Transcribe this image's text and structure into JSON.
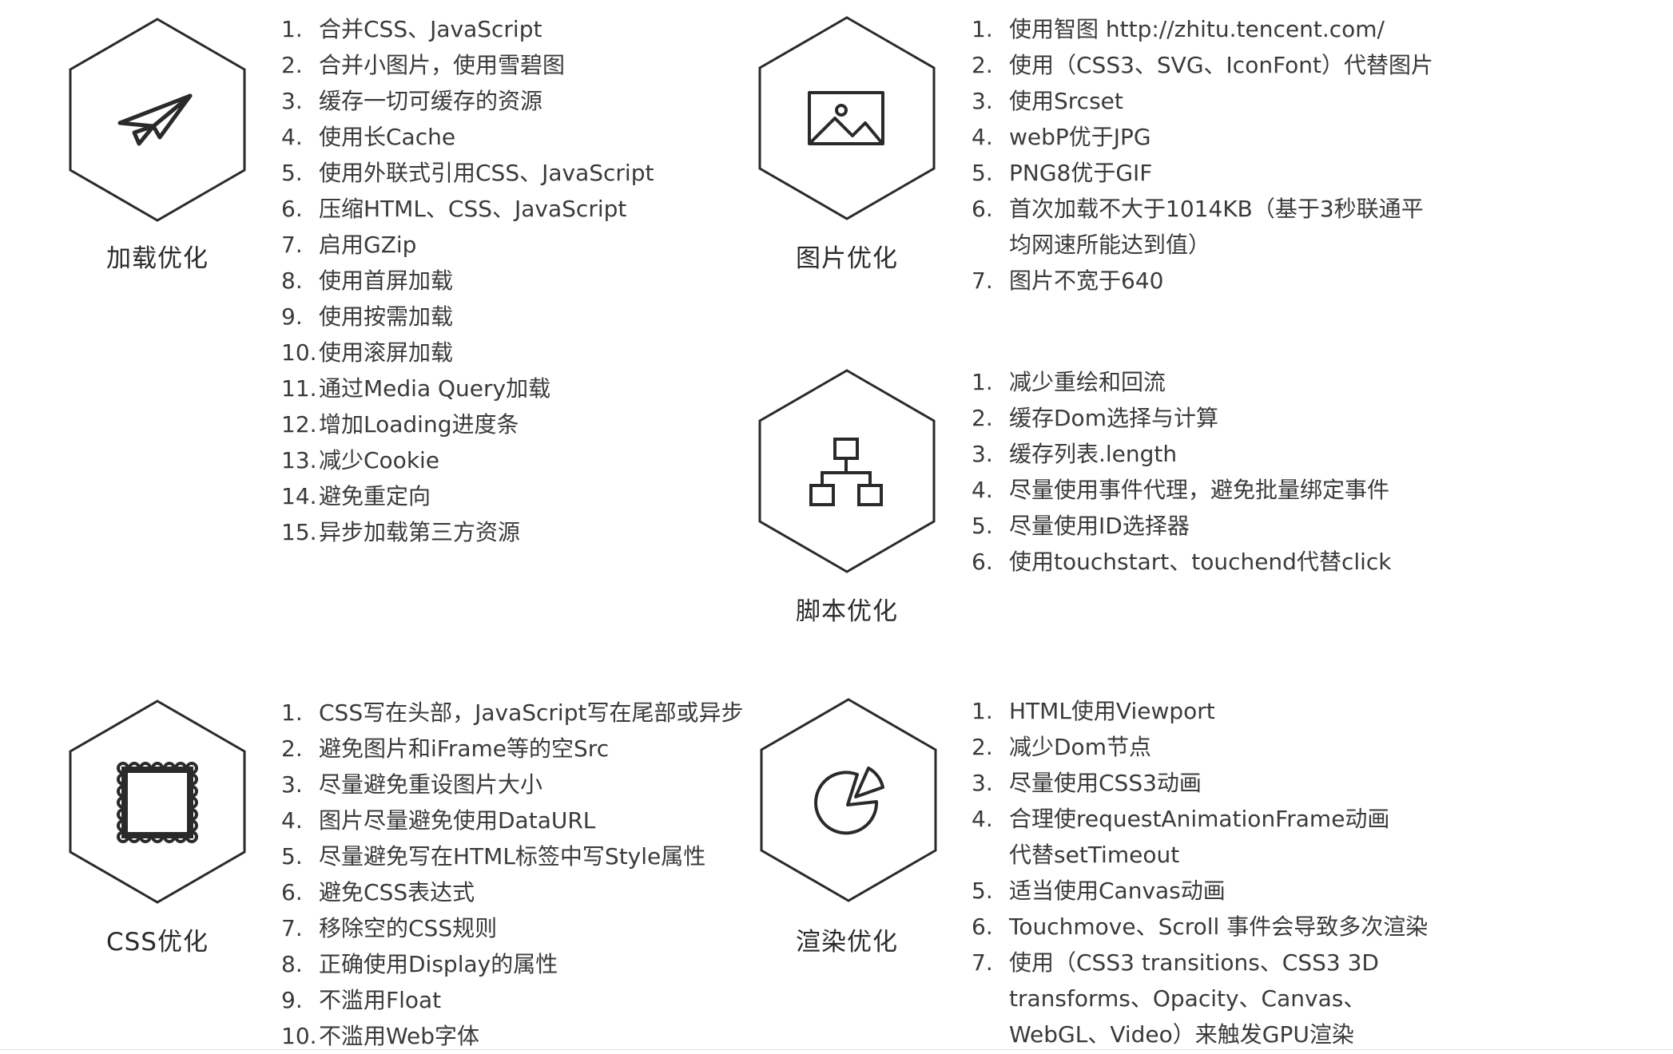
{
  "sections": {
    "loading": {
      "title": "加载优化",
      "icon": "paper-plane-icon",
      "items": [
        {
          "num": "1.",
          "text": "合并CSS、JavaScript"
        },
        {
          "num": "2.",
          "text": "合并小图片，使用雪碧图"
        },
        {
          "num": "3.",
          "text": "缓存一切可缓存的资源"
        },
        {
          "num": "4.",
          "text": "使用长Cache"
        },
        {
          "num": "5.",
          "text": "使用外联式引用CSS、JavaScript"
        },
        {
          "num": "6.",
          "text": "压缩HTML、CSS、JavaScript"
        },
        {
          "num": "7.",
          "text": "启用GZip"
        },
        {
          "num": "8.",
          "text": "使用首屏加载"
        },
        {
          "num": "9.",
          "text": "使用按需加载"
        },
        {
          "num": "10.",
          "text": "使用滚屏加载"
        },
        {
          "num": "11.",
          "text": "通过Media Query加载"
        },
        {
          "num": "12.",
          "text": "增加Loading进度条"
        },
        {
          "num": "13.",
          "text": "减少Cookie"
        },
        {
          "num": "14.",
          "text": "避免重定向"
        },
        {
          "num": "15.",
          "text": "异步加载第三方资源"
        }
      ]
    },
    "image": {
      "title": "图片优化",
      "icon": "image-icon",
      "items": [
        {
          "num": "1.",
          "text": "使用智图 http://zhitu.tencent.com/"
        },
        {
          "num": "2.",
          "text": "使用（CSS3、SVG、IconFont）代替图片"
        },
        {
          "num": "3.",
          "text": "使用Srcset"
        },
        {
          "num": "4.",
          "text": "webP优于JPG"
        },
        {
          "num": "5.",
          "text": "PNG8优于GIF"
        },
        {
          "num": "6.",
          "text": "首次加载不大于1014KB（基于3秒联通平均网速所能达到值）"
        },
        {
          "num": "7.",
          "text": "图片不宽于640"
        }
      ]
    },
    "script": {
      "title": "脚本优化",
      "icon": "sitemap-icon",
      "items": [
        {
          "num": "1.",
          "text": "减少重绘和回流"
        },
        {
          "num": "2.",
          "text": "缓存Dom选择与计算"
        },
        {
          "num": "3.",
          "text": "缓存列表.length"
        },
        {
          "num": "4.",
          "text": "尽量使用事件代理，避免批量绑定事件"
        },
        {
          "num": "5.",
          "text": "尽量使用ID选择器"
        },
        {
          "num": "6.",
          "text": "使用touchstart、touchend代替click"
        }
      ]
    },
    "css": {
      "title": "CSS优化",
      "icon": "stamp-frame-icon",
      "items": [
        {
          "num": "1.",
          "text": "CSS写在头部，JavaScript写在尾部或异步"
        },
        {
          "num": "2.",
          "text": "避免图片和iFrame等的空Src"
        },
        {
          "num": "3.",
          "text": "尽量避免重设图片大小"
        },
        {
          "num": "4.",
          "text": "图片尽量避免使用DataURL"
        },
        {
          "num": "5.",
          "text": "尽量避免写在HTML标签中写Style属性"
        },
        {
          "num": "6.",
          "text": "避免CSS表达式"
        },
        {
          "num": "7.",
          "text": "移除空的CSS规则"
        },
        {
          "num": "8.",
          "text": "正确使用Display的属性"
        },
        {
          "num": "9.",
          "text": "不滥用Float"
        },
        {
          "num": "10.",
          "text": "不滥用Web字体"
        }
      ]
    },
    "render": {
      "title": "渲染优化",
      "icon": "pie-chart-icon",
      "items": [
        {
          "num": "1.",
          "text": "HTML使用Viewport"
        },
        {
          "num": "2.",
          "text": "减少Dom节点"
        },
        {
          "num": "3.",
          "text": "尽量使用CSS3动画"
        },
        {
          "num": "4.",
          "text": "合理使requestAnimationFrame动画代替setTimeout"
        },
        {
          "num": "5.",
          "text": "适当使用Canvas动画"
        },
        {
          "num": "6.",
          "text": "Touchmove、Scroll 事件会导致多次渲染"
        },
        {
          "num": "7.",
          "text": "使用（CSS3 transitions、CSS3 3D transforms、Opacity、Canvas、WebGL、Video）来触发GPU渲染"
        }
      ]
    }
  }
}
